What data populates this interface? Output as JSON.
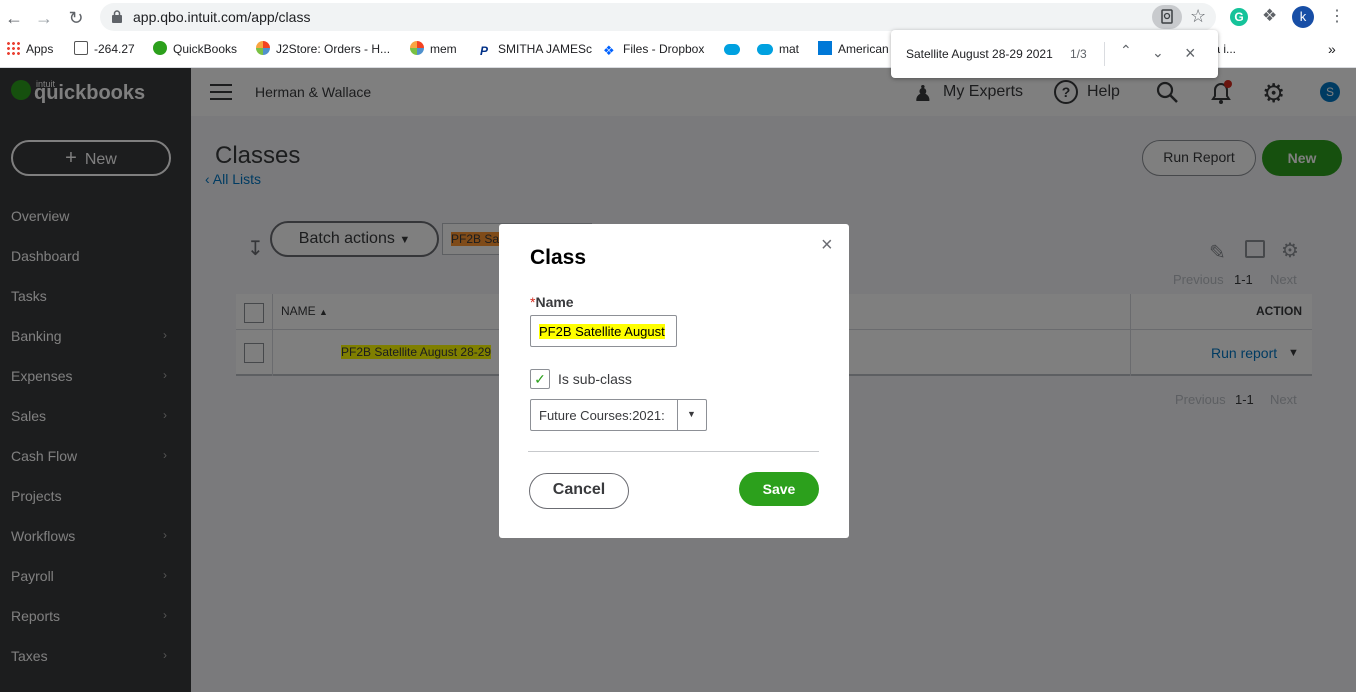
{
  "browser": {
    "url": "app.qbo.intuit.com/app/class",
    "profile_initial": "k",
    "bookmarks": [
      "Apps",
      "-264.27",
      "QuickBooks",
      "J2Store: Orders - H...",
      "mem",
      "SMITHA JAMESc",
      "Files - Dropbox",
      "",
      "mat",
      "American",
      "ta i..."
    ],
    "overflow": "»"
  },
  "find_bar": {
    "query": "Satellite August 28-29 2021",
    "count": "1/3"
  },
  "qbo": {
    "logo_small": "intuit",
    "logo": "quickbooks",
    "new_button": "New",
    "company": "Herman & Wallace",
    "my_experts": "My Experts",
    "help": "Help",
    "avatar_initial": "S",
    "nav": [
      "Overview",
      "Dashboard",
      "Tasks",
      "Banking",
      "Expenses",
      "Sales",
      "Cash Flow",
      "Projects",
      "Workflows",
      "Payroll",
      "Reports",
      "Taxes"
    ],
    "nav_has_chevron": [
      false,
      false,
      false,
      true,
      true,
      true,
      true,
      false,
      true,
      true,
      true,
      true
    ]
  },
  "page": {
    "title": "Classes",
    "all_lists": "All Lists",
    "run_report": "Run Report",
    "new": "New",
    "batch_actions": "Batch actions",
    "filter_value": "PF2B Sa",
    "pagination_top": {
      "prev": "Previous",
      "range": "1-1",
      "next": "Next"
    },
    "pagination_bottom": {
      "prev": "Previous",
      "range": "1-1",
      "next": "Next"
    },
    "table": {
      "col_name": "NAME",
      "col_action": "ACTION",
      "rows": [
        {
          "name": "PF2B Satellite August 28-29",
          "action": "Run report"
        }
      ]
    }
  },
  "modal": {
    "title": "Class",
    "name_required_mark": "*",
    "name_label": "Name",
    "name_value": "PF2B Satellite August",
    "subclass_label": "Is sub-class",
    "subclass_checked": true,
    "parent_value": "Future Courses:2021:",
    "cancel": "Cancel",
    "save": "Save"
  }
}
